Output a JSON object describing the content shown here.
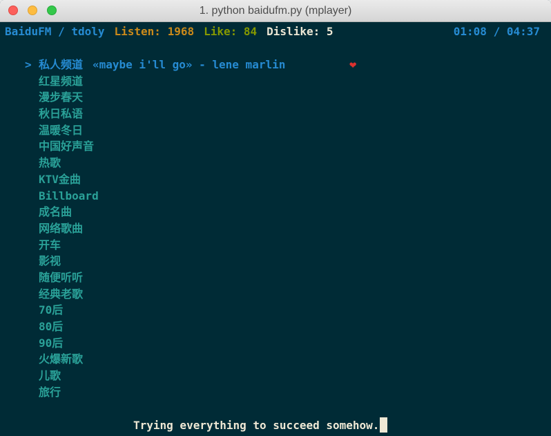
{
  "window": {
    "title": "1. python baidufm.py (mplayer)"
  },
  "status": {
    "app": "BaiduFM / tdoly",
    "listen": "Listen: 1968",
    "like": "Like: 84",
    "dislike": "Dislike: 5",
    "time": "01:08 / 04:37"
  },
  "player": {
    "cursor": ">",
    "now_playing": "«maybe i'll go» - lene marlin",
    "liked_icon": "heart-icon",
    "lyric": "Trying everything to succeed somehow."
  },
  "channels": [
    "私人频道",
    "红星频道",
    "漫步春天",
    "秋日私语",
    "温暖冬日",
    "中国好声音",
    "热歌",
    "KTV金曲",
    "Billboard",
    "成名曲",
    "网络歌曲",
    "开车",
    "影视",
    "随便听听",
    "经典老歌",
    "70后",
    "80后",
    "90后",
    "火爆新歌",
    "儿歌",
    "旅行"
  ],
  "colors": {
    "background": "#002b36",
    "blue": "#268bd2",
    "cyan": "#2aa198",
    "orange": "#cb8a1a",
    "green": "#859900",
    "red": "#dc322f",
    "foreground": "#eee8d5"
  }
}
